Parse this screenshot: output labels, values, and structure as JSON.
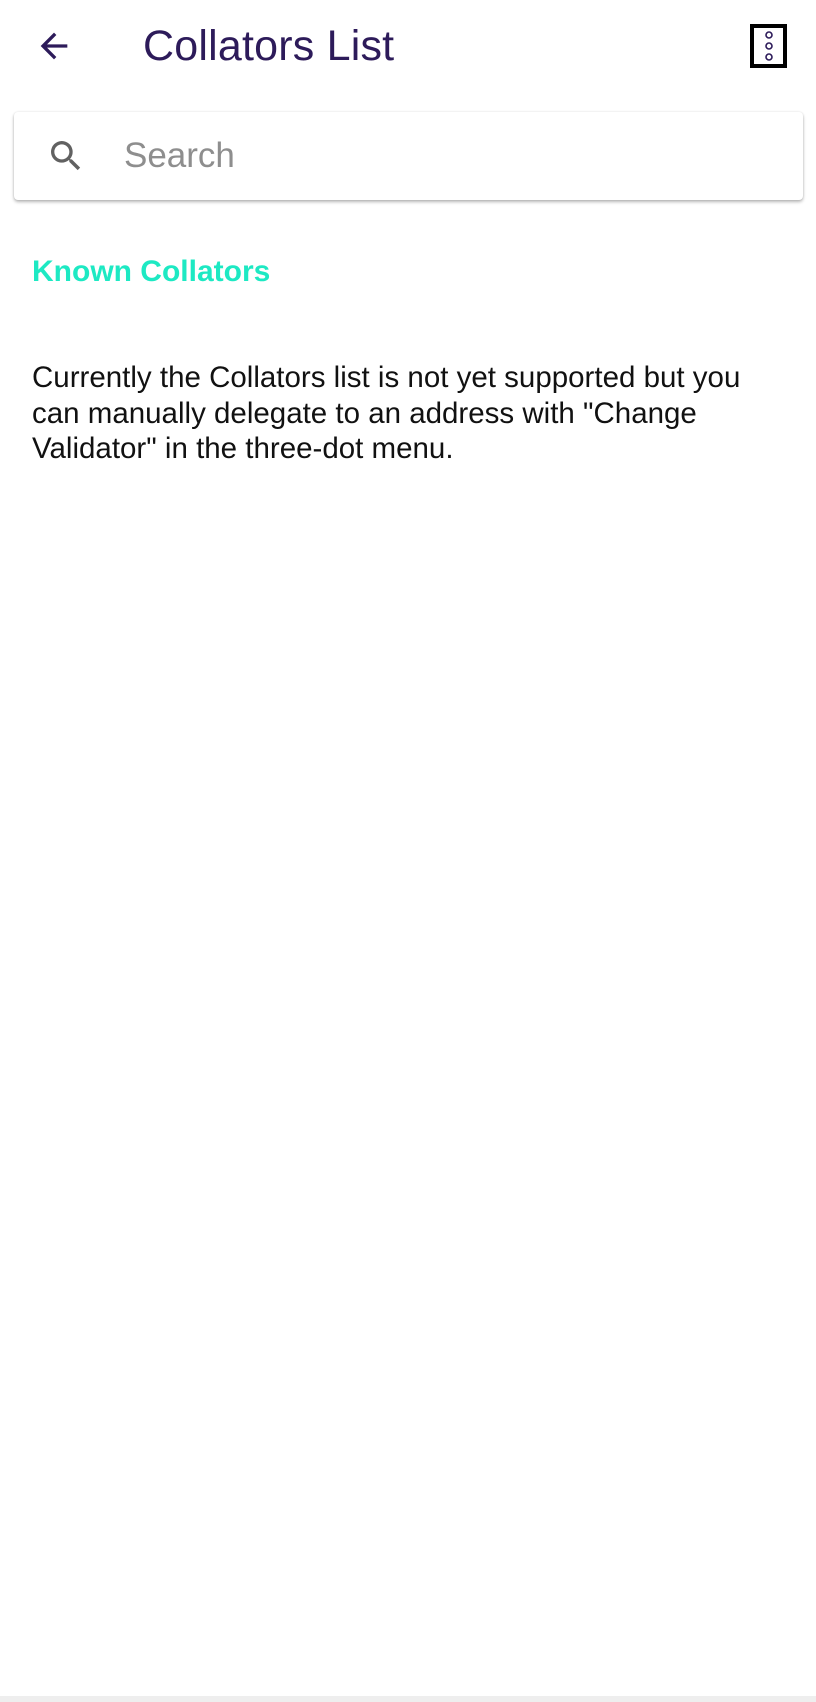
{
  "app_bar": {
    "title": "Collators List",
    "back_icon": "arrow-left-icon",
    "menu_icon": "more-vert-icon"
  },
  "search": {
    "placeholder": "Search",
    "value": "",
    "icon": "search-icon"
  },
  "section": {
    "heading": "Known Collators",
    "message": "Currently the Collators list is not yet supported but you can manually delegate to an address with \"Change Validator\" in the three-dot menu."
  },
  "colors": {
    "title": "#2d1b5a",
    "accent": "#1de9c3",
    "icon_gray": "#616161"
  }
}
